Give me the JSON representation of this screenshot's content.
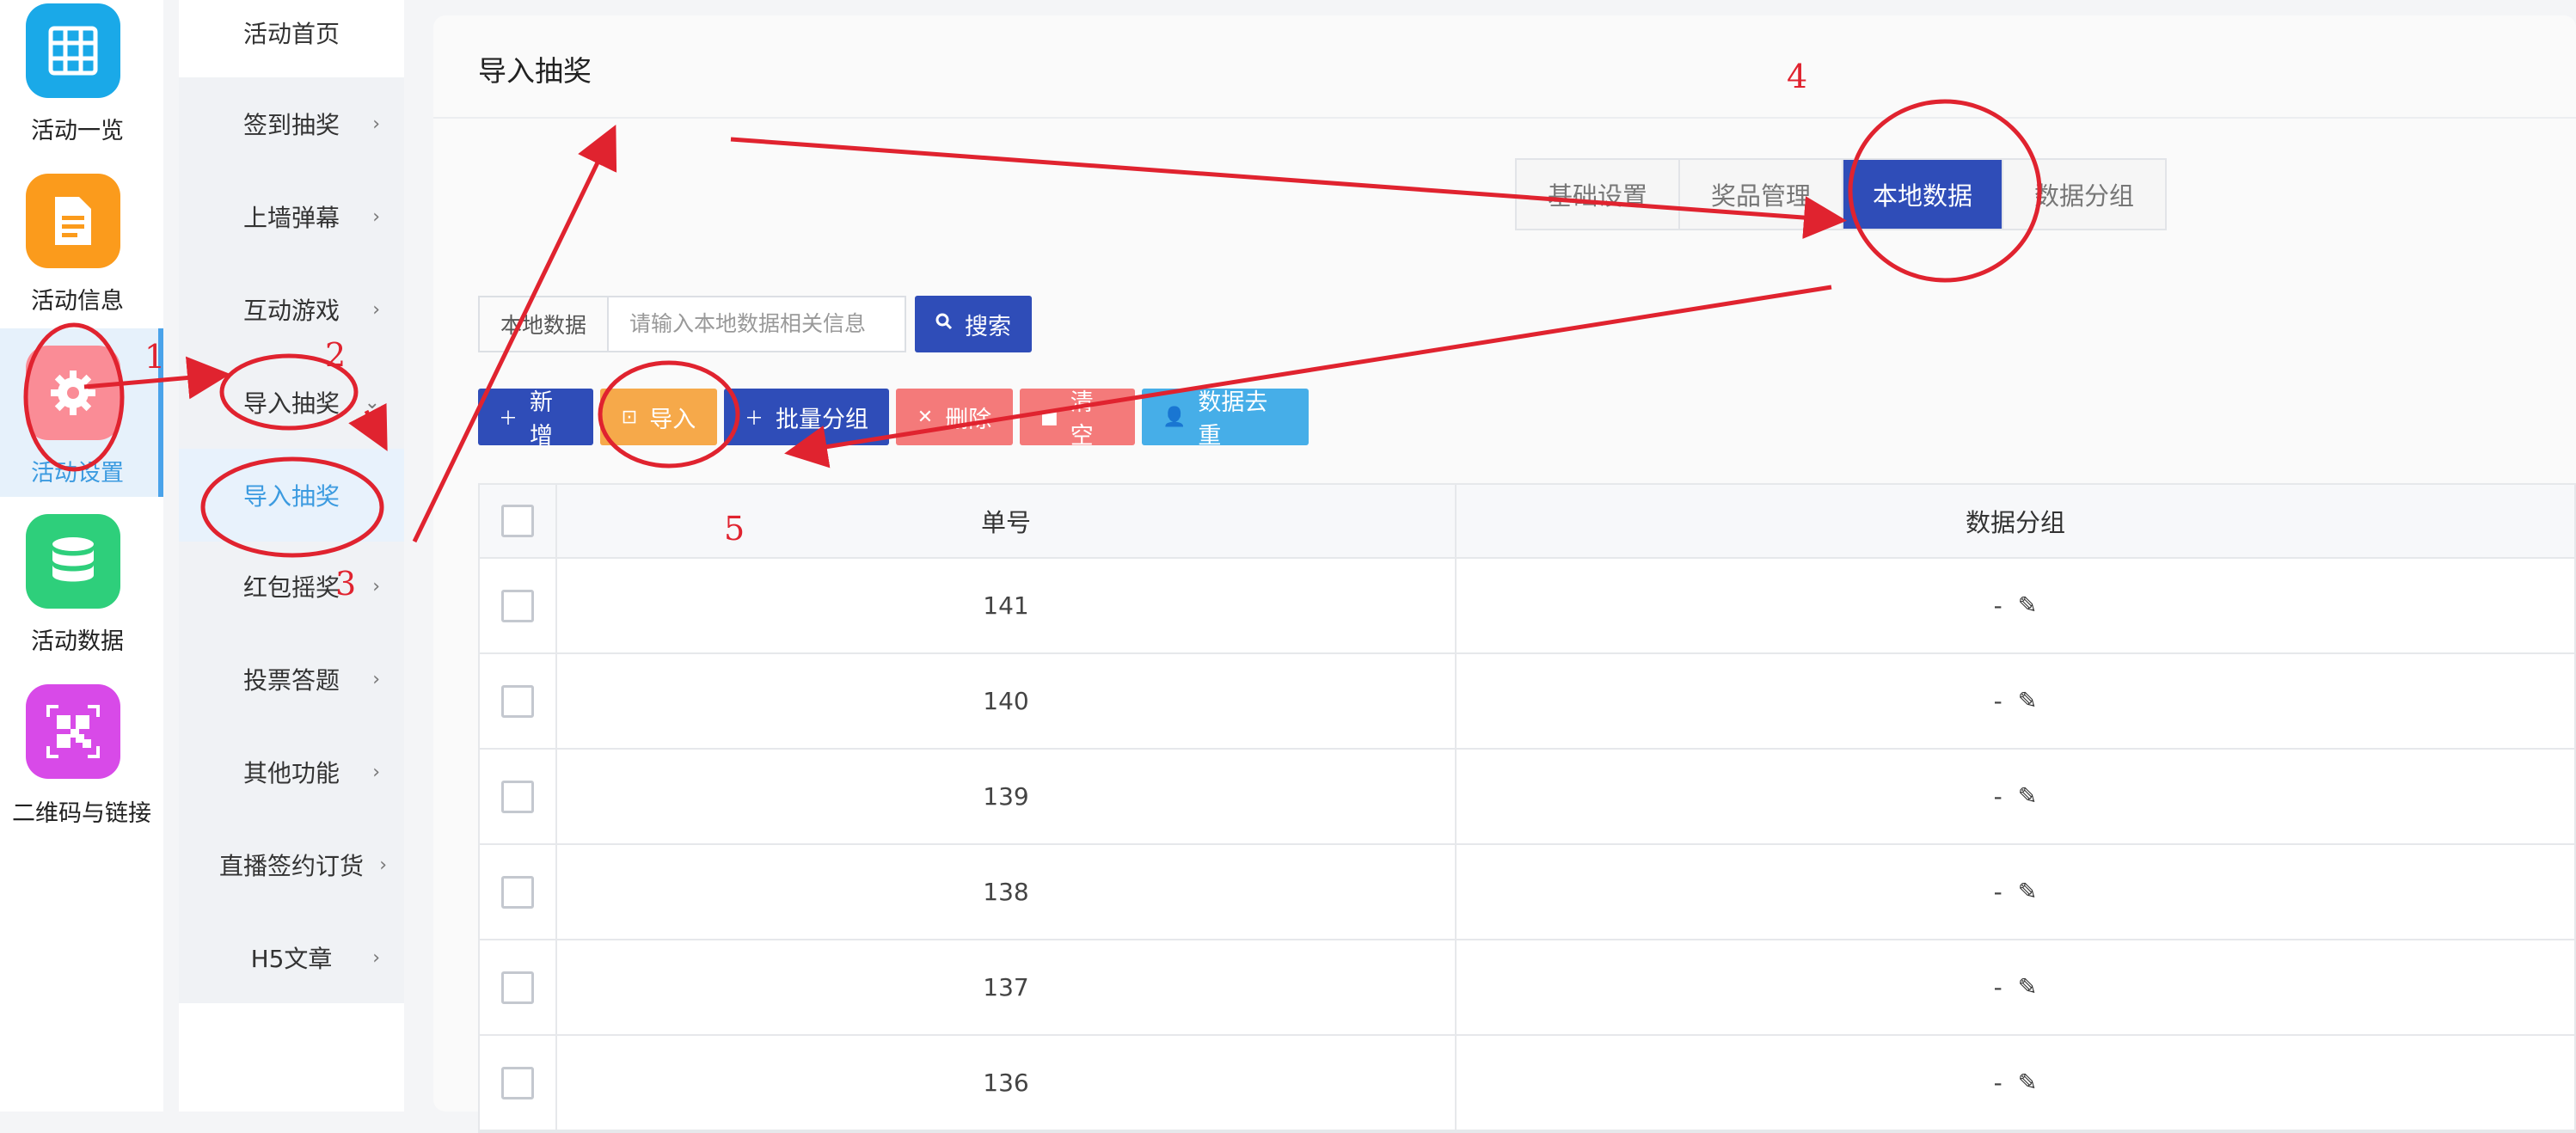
{
  "rail": {
    "items": [
      {
        "label": "活动一览",
        "icon": "grid-icon",
        "color": "#1aa9e8"
      },
      {
        "label": "活动信息",
        "icon": "document-icon",
        "color": "#fb9b1c"
      },
      {
        "label": "活动设置",
        "icon": "gear-icon",
        "color": "#fa8c96"
      },
      {
        "label": "活动数据",
        "icon": "database-icon",
        "color": "#2ecf7b"
      },
      {
        "label": "二维码与链接",
        "icon": "qrcode-icon",
        "color": "#d84ae8"
      }
    ],
    "active_index": 2
  },
  "submenu": {
    "items": [
      {
        "label": "活动首页"
      },
      {
        "label": "签到抽奖",
        "chevron": "›"
      },
      {
        "label": "上墙弹幕",
        "chevron": "›"
      },
      {
        "label": "互动游戏",
        "chevron": "›"
      },
      {
        "label": "导入抽奖",
        "chevron": "⌄"
      },
      {
        "label": "导入抽奖"
      },
      {
        "label": "红包摇奖",
        "chevron": "›"
      },
      {
        "label": "投票答题",
        "chevron": "›"
      },
      {
        "label": "其他功能",
        "chevron": "›"
      },
      {
        "label": "直播签约订货",
        "chevron": "›"
      },
      {
        "label": "H5文章",
        "chevron": "›"
      }
    ]
  },
  "main": {
    "title": "导入抽奖",
    "tabs": [
      {
        "label": "基础设置"
      },
      {
        "label": "奖品管理"
      },
      {
        "label": "本地数据"
      },
      {
        "label": "数据分组"
      }
    ],
    "active_tab": 2,
    "search": {
      "label": "本地数据",
      "placeholder": "请输入本地数据相关信息",
      "button": "搜索"
    },
    "toolbar": {
      "add": "新增",
      "import": "导入",
      "batch_group": "批量分组",
      "delete": "删除",
      "clear": "清空",
      "dedup": "数据去重"
    },
    "table": {
      "columns": [
        "单号",
        "数据分组"
      ],
      "rows": [
        {
          "num": "141",
          "group": "-"
        },
        {
          "num": "140",
          "group": "-"
        },
        {
          "num": "139",
          "group": "-"
        },
        {
          "num": "138",
          "group": "-"
        },
        {
          "num": "137",
          "group": "-"
        },
        {
          "num": "136",
          "group": "-"
        }
      ]
    }
  },
  "annotations": {
    "step_numbers": [
      "1",
      "2",
      "3",
      "4",
      "5"
    ],
    "color": "#e0232f"
  }
}
